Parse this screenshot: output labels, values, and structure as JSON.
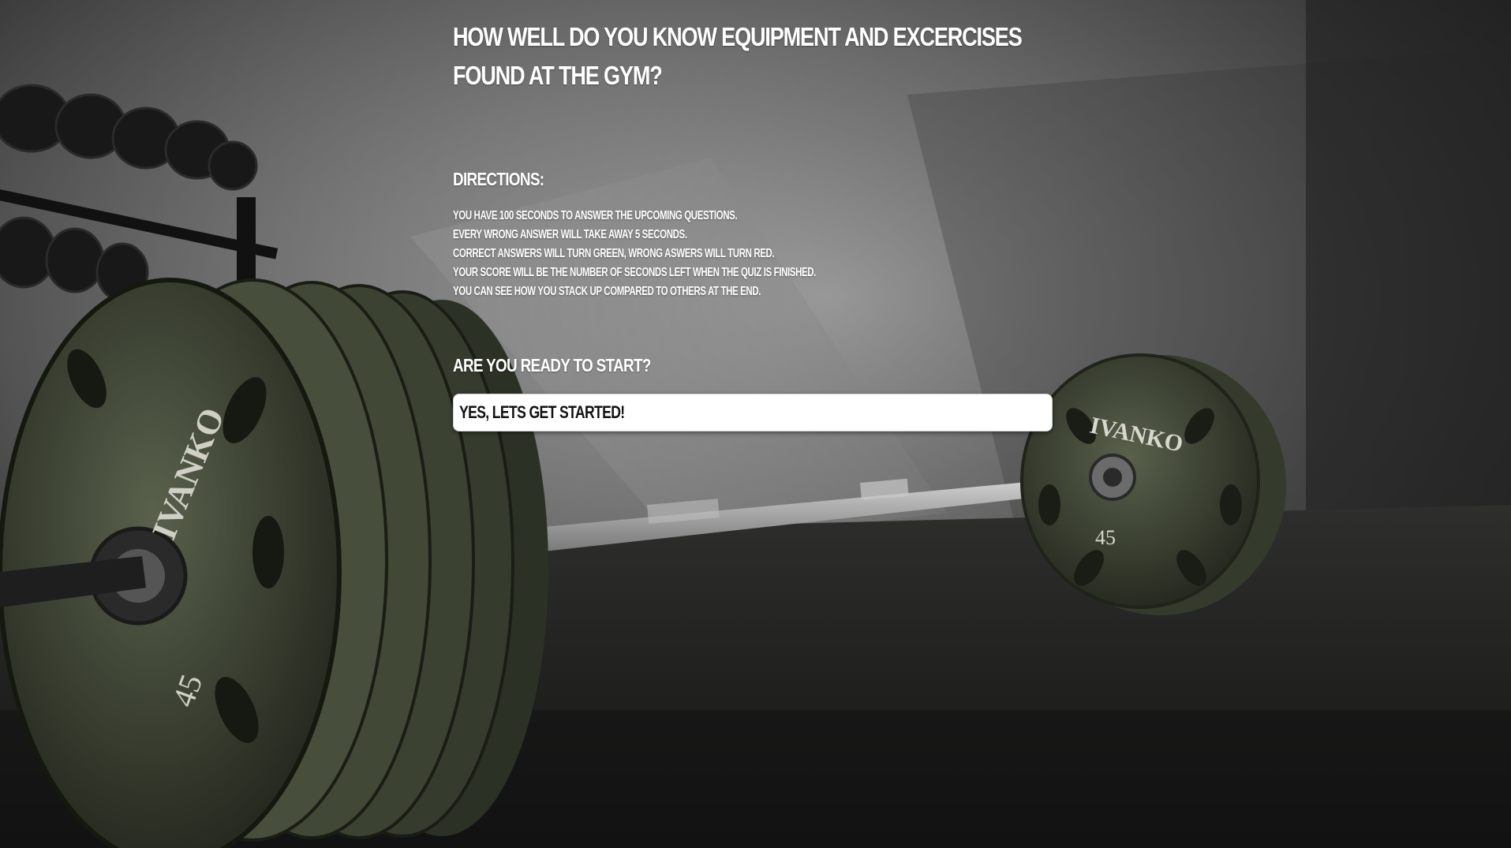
{
  "quiz": {
    "title_line_1": "How well do you know equipment and excercises",
    "title_line_2": "found at the gym?",
    "directions_heading": "Directions:",
    "directions": [
      "You have 100 seconds to answer the upcoming questions.",
      "Every wrong answer will take away 5 seconds.",
      "Correct answers will turn green, wrong aswers will turn red.",
      "Your score will be the number of seconds left when the quiz is finished.",
      "You can see how you stack up compared to others at the end."
    ],
    "ready_heading": "Are you ready to start?",
    "start_button_label": "Yes, lets get started!"
  },
  "background": {
    "image_description_icon": "barbell-gym-background",
    "plate_left_text": "IVANKO",
    "plate_right_text": "IVANKO",
    "plate_weight_left": "45",
    "plate_weight_right": "45"
  },
  "colors": {
    "text": "#ffffff",
    "button_bg": "#ffffff",
    "button_text": "#111111",
    "plate": "#3f4636"
  }
}
